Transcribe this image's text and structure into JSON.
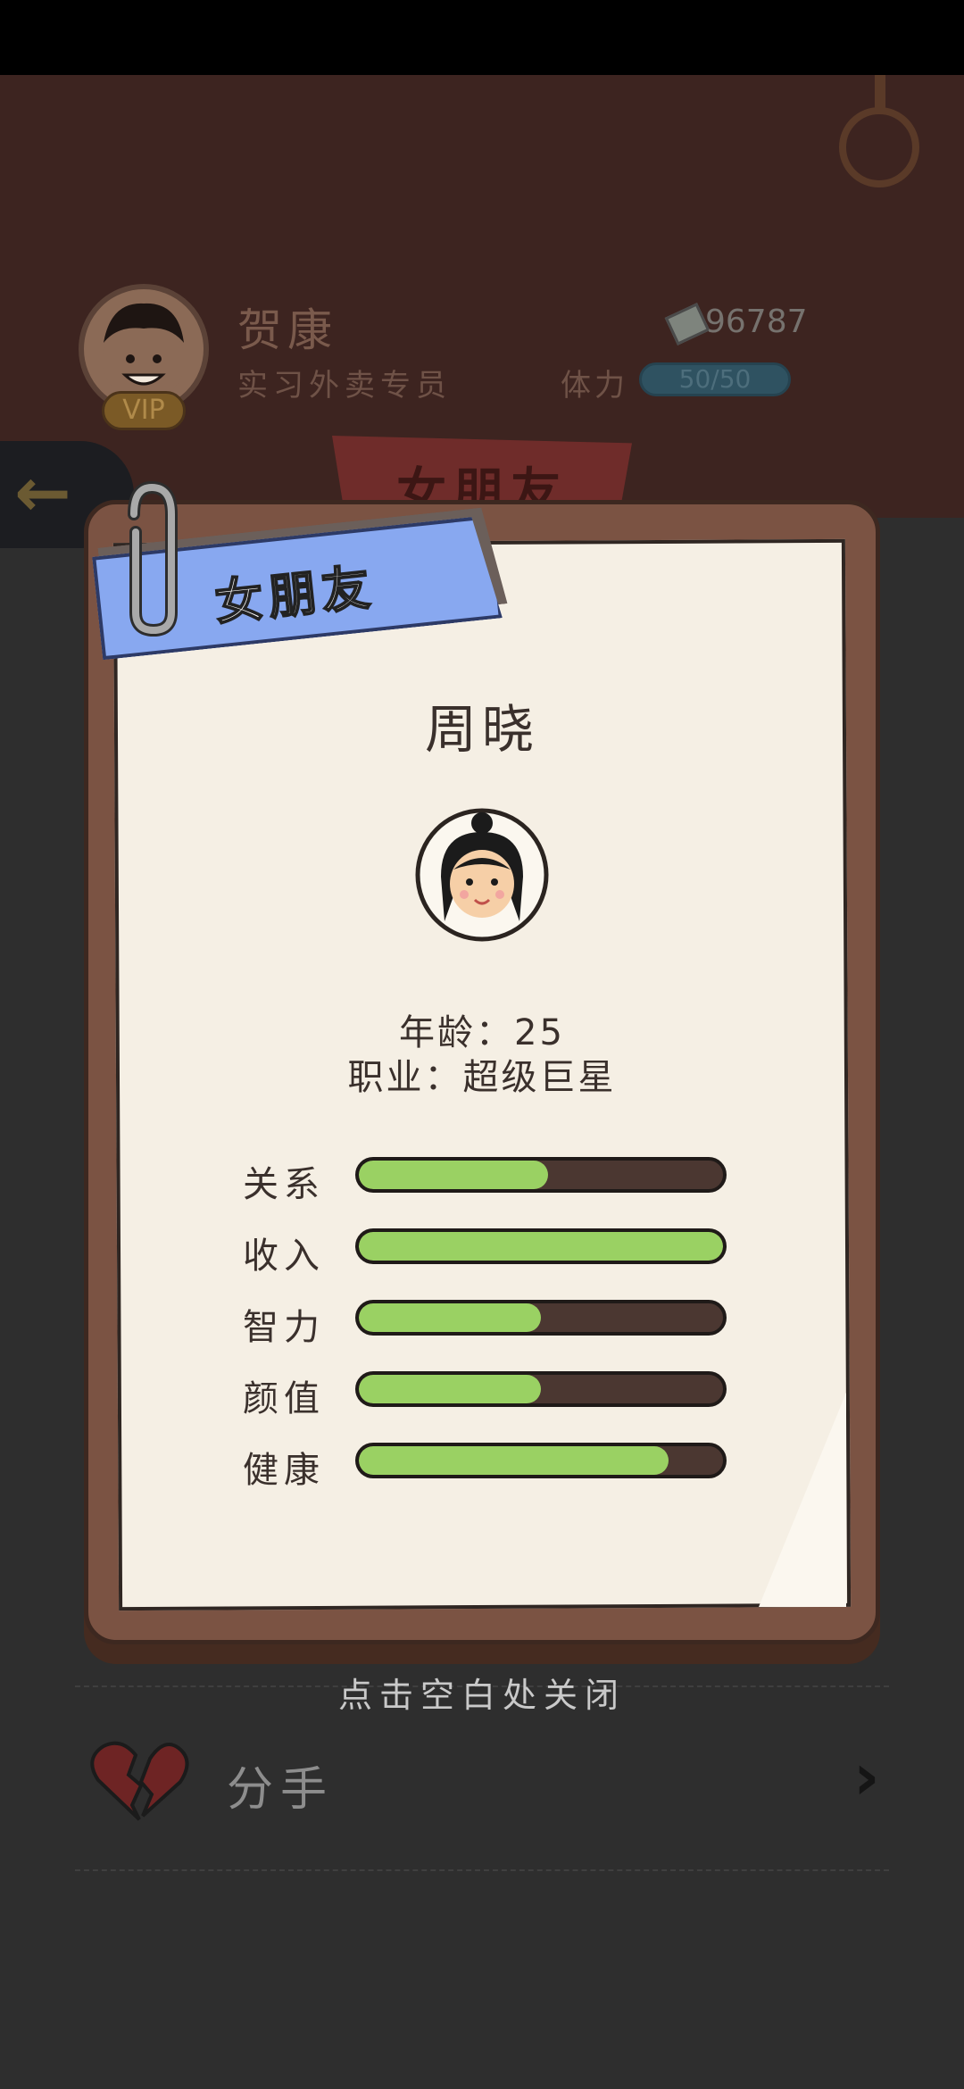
{
  "header": {
    "player_name": "贺康",
    "player_title": "实习外卖专员",
    "vip_badge": "VIP",
    "money": "96787",
    "stamina_label": "体力",
    "stamina_value": "50/50",
    "tab_title": "女朋友"
  },
  "card": {
    "ribbon_title": "女朋友",
    "name": "周晓",
    "age_line": "年龄：25",
    "job_line": "职业：超级巨星",
    "stats": [
      {
        "label": "关系",
        "level": 0.52
      },
      {
        "label": "收入",
        "level": 1.0
      },
      {
        "label": "智力",
        "level": 0.5
      },
      {
        "label": "颜值",
        "level": 0.5
      },
      {
        "label": "健康",
        "level": 0.85
      }
    ]
  },
  "close_hint": "点击空白处关闭",
  "list": {
    "breakup_label": "分手"
  },
  "colors": {
    "ribbon": "#88a8f0",
    "stat_fill": "#9ad163",
    "stat_track": "#4b3731",
    "board": "#7b5343",
    "paper": "#f5efe4"
  }
}
